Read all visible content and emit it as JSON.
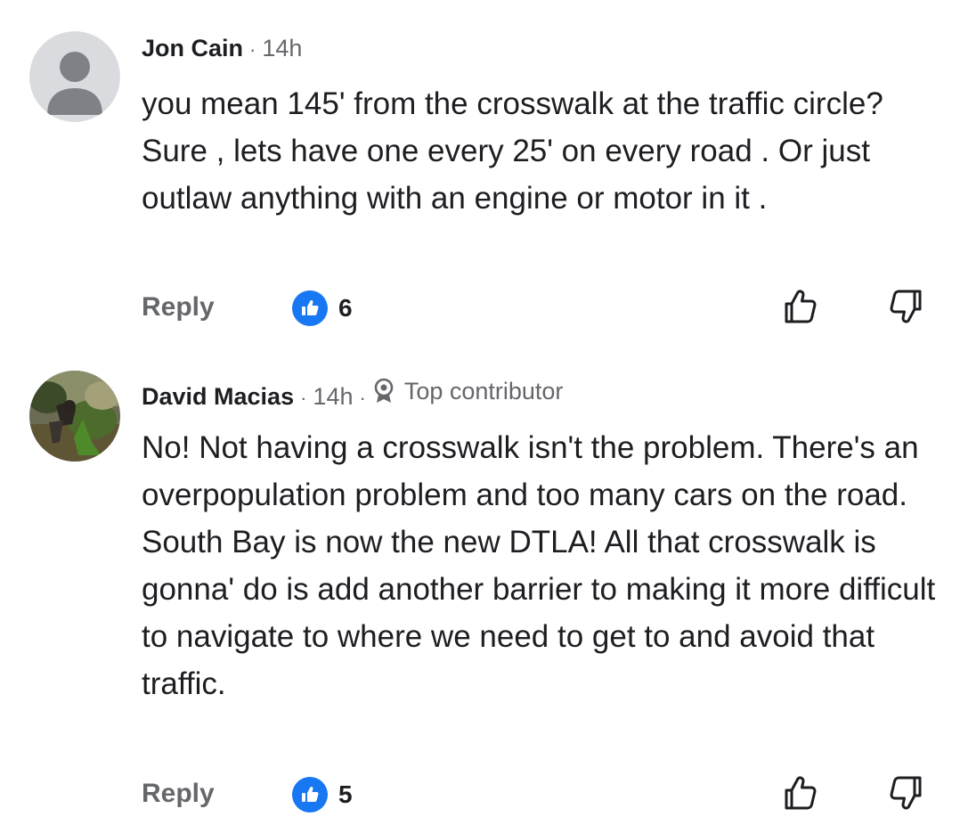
{
  "comments": [
    {
      "author": "Jon Cain",
      "time": "14h",
      "separator": "·",
      "badge": "",
      "text": "you mean 145' from the crosswalk at the traffic circle? Sure , lets have one every 25' on every road . Or just outlaw anything with an engine or motor in it .",
      "reply_label": "Reply",
      "like_count": "6",
      "avatar_icon": "default-person-icon"
    },
    {
      "author": "David Macias",
      "time": "14h",
      "separator": "·",
      "badge": "Top contributor",
      "text": "No! Not having a crosswalk isn't the problem. There's an overpopulation problem and too many cars on the road. South Bay is now the new DTLA! All that crosswalk is gonna' do is add another barrier to making it more difficult to navigate to where we need to get to and avoid that traffic.",
      "reply_label": "Reply",
      "like_count": "5",
      "avatar_icon": "profile-photo"
    }
  ],
  "colors": {
    "like_blue": "#1877f2",
    "meta_gray": "#65676b",
    "text": "#1c1e21"
  }
}
